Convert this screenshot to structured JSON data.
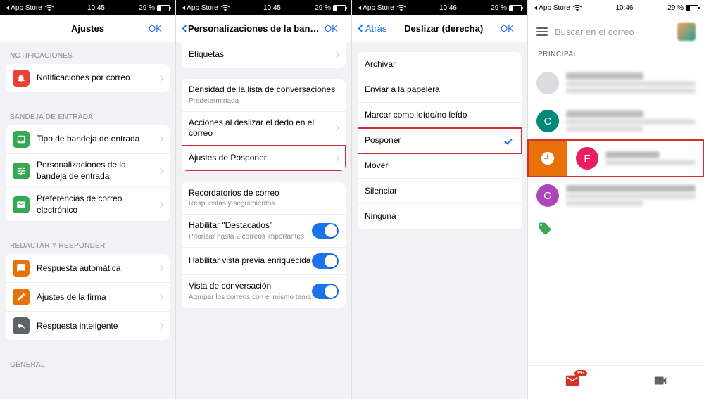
{
  "status": {
    "app_back": "App Store",
    "time1": "10:45",
    "time2": "10:45",
    "time3": "10:46",
    "time4": "10:46",
    "battery": "29 %"
  },
  "s1": {
    "title": "Ajustes",
    "ok": "OK",
    "sec_notif": "NOTIFICACIONES",
    "notif_mail": "Notificaciones por correo",
    "sec_inbox": "BANDEJA DE ENTRADA",
    "inbox_type": "Tipo de bandeja de entrada",
    "inbox_custom": "Personalizaciones de la bandeja de entrada",
    "email_prefs": "Preferencias de correo electrónico",
    "sec_compose": "REDACTAR Y RESPONDER",
    "auto_reply": "Respuesta automática",
    "signature": "Ajustes de la firma",
    "smart_reply": "Respuesta inteligente",
    "sec_general": "GENERAL"
  },
  "s2": {
    "title": "Personalizaciones de la bandeja d...",
    "ok": "OK",
    "labels": "Etiquetas",
    "density": "Densidad de la lista de conversaciones",
    "density_sub": "Predeterminada",
    "swipe_actions": "Acciones al deslizar el dedo en el correo",
    "snooze": "Ajustes de Posponer",
    "reminders": "Recordatorios de correo",
    "reminders_sub": "Respuestas y seguimientos",
    "featured": "Habilitar \"Destacados\"",
    "featured_sub": "Priorizar hasta 2 correos importantes",
    "rich_preview": "Habilitar vista previa enriquecida",
    "conversation": "Vista de conversación",
    "conversation_sub": "Agrupar los correos con el mismo tema"
  },
  "s3": {
    "back": "Atrás",
    "title": "Deslizar (derecha)",
    "ok": "OK",
    "opts": {
      "archive": "Archivar",
      "trash": "Enviar a la papelera",
      "mark": "Marcar como leído/no leído",
      "snooze": "Posponer",
      "move": "Mover",
      "mute": "Silenciar",
      "none": "Ninguna"
    }
  },
  "s4": {
    "search": "Buscar en el correo",
    "tab": "PRINCIPAL",
    "avatars": {
      "c": "C",
      "f": "F",
      "g": "G"
    },
    "colors": {
      "c": "#00897b",
      "f": "#e91e63",
      "g": "#ab47bc",
      "grey": "#dadce0"
    }
  },
  "icon_colors": {
    "red": "#ea4335",
    "green": "#34a853",
    "blue": "#4285f4",
    "orange": "#e8710a",
    "grey": "#5f6368"
  }
}
